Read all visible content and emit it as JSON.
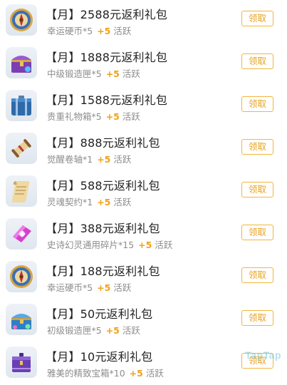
{
  "claim_label": "领取",
  "plus_label": "+5",
  "active_label": "活跃",
  "watermark": "TapTap",
  "colors": {
    "plus": "#f0a11a",
    "button_border": "#f2b63c",
    "button_text": "#eaa222"
  },
  "items": [
    {
      "title": "【月】2588元返利礼包",
      "reward": "幸运硬币*5",
      "icon": "compass-coin-icon"
    },
    {
      "title": "【月】1888元返利礼包",
      "reward": "中级锻造匣*5",
      "icon": "purple-chest-icon"
    },
    {
      "title": "【月】1588元返利礼包",
      "reward": "贵重礼物箱*5",
      "icon": "blue-suitcase-icon"
    },
    {
      "title": "【月】888元返利礼包",
      "reward": "觉醒卷轴*1",
      "icon": "scroll-icon"
    },
    {
      "title": "【月】588元返利礼包",
      "reward": "灵魂契约*1",
      "icon": "parchment-icon"
    },
    {
      "title": "【月】388元返利礼包",
      "reward": "史诗幻灵通用碎片*15",
      "icon": "pink-shard-icon"
    },
    {
      "title": "【月】188元返利礼包",
      "reward": "幸运硬币*5",
      "icon": "compass-coin-icon"
    },
    {
      "title": "【月】50元返利礼包",
      "reward": "初级锻造匣*5",
      "icon": "blue-chest-icon"
    },
    {
      "title": "【月】10元返利礼包",
      "reward": "雅美的精致宝箱*10",
      "icon": "purple-box-icon"
    }
  ]
}
